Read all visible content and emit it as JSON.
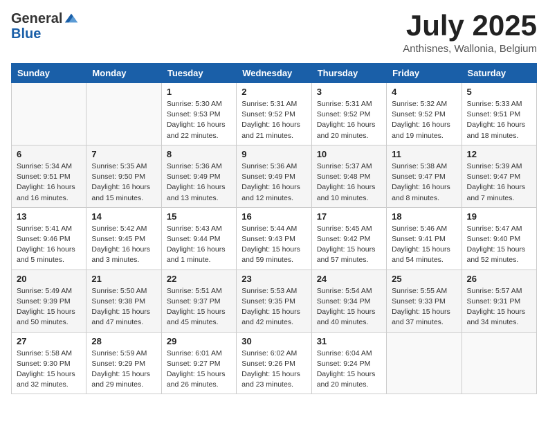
{
  "header": {
    "logo_general": "General",
    "logo_blue": "Blue",
    "month": "July 2025",
    "location": "Anthisnes, Wallonia, Belgium"
  },
  "days_of_week": [
    "Sunday",
    "Monday",
    "Tuesday",
    "Wednesday",
    "Thursday",
    "Friday",
    "Saturday"
  ],
  "weeks": [
    [
      {
        "day": "",
        "info": ""
      },
      {
        "day": "",
        "info": ""
      },
      {
        "day": "1",
        "info": "Sunrise: 5:30 AM\nSunset: 9:53 PM\nDaylight: 16 hours\nand 22 minutes."
      },
      {
        "day": "2",
        "info": "Sunrise: 5:31 AM\nSunset: 9:52 PM\nDaylight: 16 hours\nand 21 minutes."
      },
      {
        "day": "3",
        "info": "Sunrise: 5:31 AM\nSunset: 9:52 PM\nDaylight: 16 hours\nand 20 minutes."
      },
      {
        "day": "4",
        "info": "Sunrise: 5:32 AM\nSunset: 9:52 PM\nDaylight: 16 hours\nand 19 minutes."
      },
      {
        "day": "5",
        "info": "Sunrise: 5:33 AM\nSunset: 9:51 PM\nDaylight: 16 hours\nand 18 minutes."
      }
    ],
    [
      {
        "day": "6",
        "info": "Sunrise: 5:34 AM\nSunset: 9:51 PM\nDaylight: 16 hours\nand 16 minutes."
      },
      {
        "day": "7",
        "info": "Sunrise: 5:35 AM\nSunset: 9:50 PM\nDaylight: 16 hours\nand 15 minutes."
      },
      {
        "day": "8",
        "info": "Sunrise: 5:36 AM\nSunset: 9:49 PM\nDaylight: 16 hours\nand 13 minutes."
      },
      {
        "day": "9",
        "info": "Sunrise: 5:36 AM\nSunset: 9:49 PM\nDaylight: 16 hours\nand 12 minutes."
      },
      {
        "day": "10",
        "info": "Sunrise: 5:37 AM\nSunset: 9:48 PM\nDaylight: 16 hours\nand 10 minutes."
      },
      {
        "day": "11",
        "info": "Sunrise: 5:38 AM\nSunset: 9:47 PM\nDaylight: 16 hours\nand 8 minutes."
      },
      {
        "day": "12",
        "info": "Sunrise: 5:39 AM\nSunset: 9:47 PM\nDaylight: 16 hours\nand 7 minutes."
      }
    ],
    [
      {
        "day": "13",
        "info": "Sunrise: 5:41 AM\nSunset: 9:46 PM\nDaylight: 16 hours\nand 5 minutes."
      },
      {
        "day": "14",
        "info": "Sunrise: 5:42 AM\nSunset: 9:45 PM\nDaylight: 16 hours\nand 3 minutes."
      },
      {
        "day": "15",
        "info": "Sunrise: 5:43 AM\nSunset: 9:44 PM\nDaylight: 16 hours\nand 1 minute."
      },
      {
        "day": "16",
        "info": "Sunrise: 5:44 AM\nSunset: 9:43 PM\nDaylight: 15 hours\nand 59 minutes."
      },
      {
        "day": "17",
        "info": "Sunrise: 5:45 AM\nSunset: 9:42 PM\nDaylight: 15 hours\nand 57 minutes."
      },
      {
        "day": "18",
        "info": "Sunrise: 5:46 AM\nSunset: 9:41 PM\nDaylight: 15 hours\nand 54 minutes."
      },
      {
        "day": "19",
        "info": "Sunrise: 5:47 AM\nSunset: 9:40 PM\nDaylight: 15 hours\nand 52 minutes."
      }
    ],
    [
      {
        "day": "20",
        "info": "Sunrise: 5:49 AM\nSunset: 9:39 PM\nDaylight: 15 hours\nand 50 minutes."
      },
      {
        "day": "21",
        "info": "Sunrise: 5:50 AM\nSunset: 9:38 PM\nDaylight: 15 hours\nand 47 minutes."
      },
      {
        "day": "22",
        "info": "Sunrise: 5:51 AM\nSunset: 9:37 PM\nDaylight: 15 hours\nand 45 minutes."
      },
      {
        "day": "23",
        "info": "Sunrise: 5:53 AM\nSunset: 9:35 PM\nDaylight: 15 hours\nand 42 minutes."
      },
      {
        "day": "24",
        "info": "Sunrise: 5:54 AM\nSunset: 9:34 PM\nDaylight: 15 hours\nand 40 minutes."
      },
      {
        "day": "25",
        "info": "Sunrise: 5:55 AM\nSunset: 9:33 PM\nDaylight: 15 hours\nand 37 minutes."
      },
      {
        "day": "26",
        "info": "Sunrise: 5:57 AM\nSunset: 9:31 PM\nDaylight: 15 hours\nand 34 minutes."
      }
    ],
    [
      {
        "day": "27",
        "info": "Sunrise: 5:58 AM\nSunset: 9:30 PM\nDaylight: 15 hours\nand 32 minutes."
      },
      {
        "day": "28",
        "info": "Sunrise: 5:59 AM\nSunset: 9:29 PM\nDaylight: 15 hours\nand 29 minutes."
      },
      {
        "day": "29",
        "info": "Sunrise: 6:01 AM\nSunset: 9:27 PM\nDaylight: 15 hours\nand 26 minutes."
      },
      {
        "day": "30",
        "info": "Sunrise: 6:02 AM\nSunset: 9:26 PM\nDaylight: 15 hours\nand 23 minutes."
      },
      {
        "day": "31",
        "info": "Sunrise: 6:04 AM\nSunset: 9:24 PM\nDaylight: 15 hours\nand 20 minutes."
      },
      {
        "day": "",
        "info": ""
      },
      {
        "day": "",
        "info": ""
      }
    ]
  ]
}
